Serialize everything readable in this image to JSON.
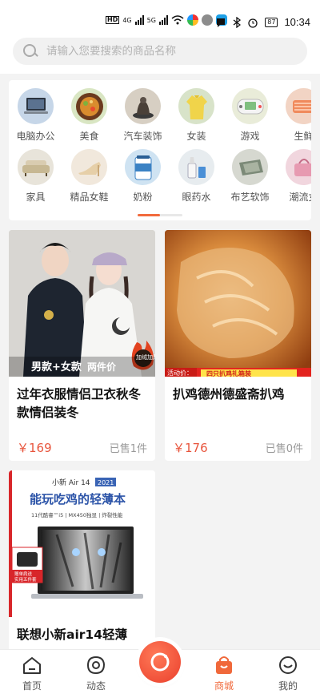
{
  "status_bar": {
    "time": "10:34",
    "battery": "87",
    "network_1": "HD",
    "network_2": "4G",
    "network_3": "5G"
  },
  "search": {
    "placeholder": "请输入您要搜索的商品名称"
  },
  "categories": {
    "row1": [
      {
        "label": "电脑办公",
        "icon": "laptop-icon"
      },
      {
        "label": "美食",
        "icon": "food-icon"
      },
      {
        "label": "汽车装饰",
        "icon": "car-ornament-icon"
      },
      {
        "label": "女装",
        "icon": "womens-clothing-icon"
      },
      {
        "label": "游戏",
        "icon": "game-console-icon"
      },
      {
        "label": "生鲜",
        "icon": "fresh-food-icon"
      }
    ],
    "row2": [
      {
        "label": "家具",
        "icon": "sofa-icon"
      },
      {
        "label": "精品女鞋",
        "icon": "high-heel-icon"
      },
      {
        "label": "奶粉",
        "icon": "milk-powder-icon"
      },
      {
        "label": "眼药水",
        "icon": "eye-drops-icon"
      },
      {
        "label": "布艺软饰",
        "icon": "rug-icon"
      },
      {
        "label": "潮流女",
        "icon": "handbag-icon"
      }
    ],
    "pager": {
      "pages": 2,
      "active": 1
    }
  },
  "products": [
    {
      "title": "过年衣服情侣卫衣秋冬款情侣装冬",
      "price": "￥169",
      "sold": "已售1件",
      "image_text": {
        "caption": "男款+女款",
        "tag": "两件价",
        "badge": "加绒加厚"
      }
    },
    {
      "title": "扒鸡德州德盛斋扒鸡",
      "price": "￥176",
      "sold": "已售0件",
      "image_text": {
        "promo": "活动价：",
        "banner": "四只扒鸡礼箱装"
      }
    },
    {
      "title": "联想小新air14轻薄",
      "image_text": {
        "model": "小新 Air 14",
        "year": "2021",
        "headline": "能玩吃鸡的轻薄本",
        "spec": "11代酷睿™i5 | MX450独显 | 炸裂性能",
        "gift_line1": "赠单肩送",
        "gift_line2": "实用五件套"
      }
    }
  ],
  "bottom_nav": [
    {
      "label": "首页",
      "icon": "home-icon"
    },
    {
      "label": "动态",
      "icon": "moments-icon"
    },
    {
      "label": "",
      "icon": "camera-icon"
    },
    {
      "label": "商城",
      "icon": "shopping-bag-icon"
    },
    {
      "label": "我的",
      "icon": "profile-icon"
    }
  ],
  "colors": {
    "accent": "#f0683a",
    "price": "#e8553d",
    "page_bg": "#f3f3f3"
  }
}
